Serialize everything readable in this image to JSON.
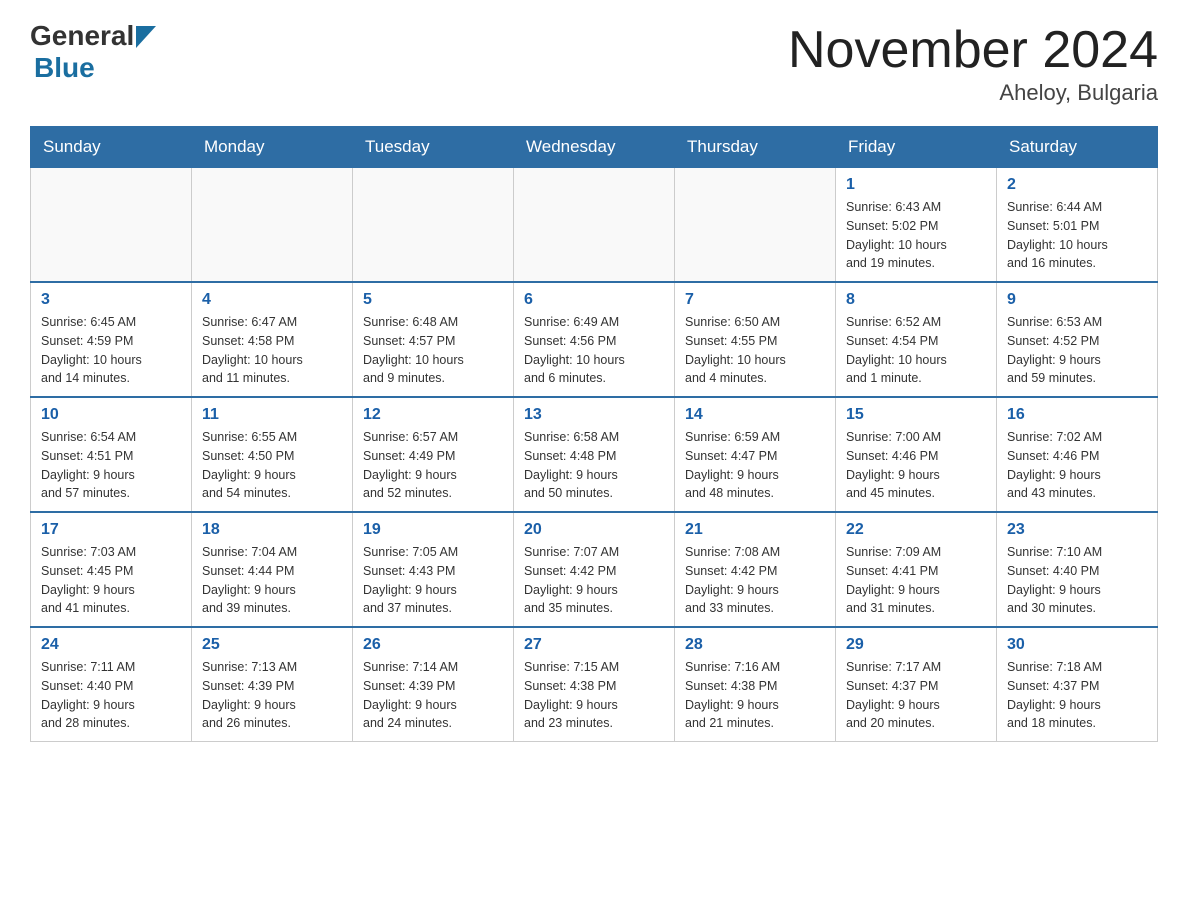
{
  "header": {
    "logo_general": "General",
    "logo_blue": "Blue",
    "month_title": "November 2024",
    "location": "Aheloy, Bulgaria"
  },
  "weekdays": [
    "Sunday",
    "Monday",
    "Tuesday",
    "Wednesday",
    "Thursday",
    "Friday",
    "Saturday"
  ],
  "weeks": [
    [
      {
        "day": "",
        "info": ""
      },
      {
        "day": "",
        "info": ""
      },
      {
        "day": "",
        "info": ""
      },
      {
        "day": "",
        "info": ""
      },
      {
        "day": "",
        "info": ""
      },
      {
        "day": "1",
        "info": "Sunrise: 6:43 AM\nSunset: 5:02 PM\nDaylight: 10 hours\nand 19 minutes."
      },
      {
        "day": "2",
        "info": "Sunrise: 6:44 AM\nSunset: 5:01 PM\nDaylight: 10 hours\nand 16 minutes."
      }
    ],
    [
      {
        "day": "3",
        "info": "Sunrise: 6:45 AM\nSunset: 4:59 PM\nDaylight: 10 hours\nand 14 minutes."
      },
      {
        "day": "4",
        "info": "Sunrise: 6:47 AM\nSunset: 4:58 PM\nDaylight: 10 hours\nand 11 minutes."
      },
      {
        "day": "5",
        "info": "Sunrise: 6:48 AM\nSunset: 4:57 PM\nDaylight: 10 hours\nand 9 minutes."
      },
      {
        "day": "6",
        "info": "Sunrise: 6:49 AM\nSunset: 4:56 PM\nDaylight: 10 hours\nand 6 minutes."
      },
      {
        "day": "7",
        "info": "Sunrise: 6:50 AM\nSunset: 4:55 PM\nDaylight: 10 hours\nand 4 minutes."
      },
      {
        "day": "8",
        "info": "Sunrise: 6:52 AM\nSunset: 4:54 PM\nDaylight: 10 hours\nand 1 minute."
      },
      {
        "day": "9",
        "info": "Sunrise: 6:53 AM\nSunset: 4:52 PM\nDaylight: 9 hours\nand 59 minutes."
      }
    ],
    [
      {
        "day": "10",
        "info": "Sunrise: 6:54 AM\nSunset: 4:51 PM\nDaylight: 9 hours\nand 57 minutes."
      },
      {
        "day": "11",
        "info": "Sunrise: 6:55 AM\nSunset: 4:50 PM\nDaylight: 9 hours\nand 54 minutes."
      },
      {
        "day": "12",
        "info": "Sunrise: 6:57 AM\nSunset: 4:49 PM\nDaylight: 9 hours\nand 52 minutes."
      },
      {
        "day": "13",
        "info": "Sunrise: 6:58 AM\nSunset: 4:48 PM\nDaylight: 9 hours\nand 50 minutes."
      },
      {
        "day": "14",
        "info": "Sunrise: 6:59 AM\nSunset: 4:47 PM\nDaylight: 9 hours\nand 48 minutes."
      },
      {
        "day": "15",
        "info": "Sunrise: 7:00 AM\nSunset: 4:46 PM\nDaylight: 9 hours\nand 45 minutes."
      },
      {
        "day": "16",
        "info": "Sunrise: 7:02 AM\nSunset: 4:46 PM\nDaylight: 9 hours\nand 43 minutes."
      }
    ],
    [
      {
        "day": "17",
        "info": "Sunrise: 7:03 AM\nSunset: 4:45 PM\nDaylight: 9 hours\nand 41 minutes."
      },
      {
        "day": "18",
        "info": "Sunrise: 7:04 AM\nSunset: 4:44 PM\nDaylight: 9 hours\nand 39 minutes."
      },
      {
        "day": "19",
        "info": "Sunrise: 7:05 AM\nSunset: 4:43 PM\nDaylight: 9 hours\nand 37 minutes."
      },
      {
        "day": "20",
        "info": "Sunrise: 7:07 AM\nSunset: 4:42 PM\nDaylight: 9 hours\nand 35 minutes."
      },
      {
        "day": "21",
        "info": "Sunrise: 7:08 AM\nSunset: 4:42 PM\nDaylight: 9 hours\nand 33 minutes."
      },
      {
        "day": "22",
        "info": "Sunrise: 7:09 AM\nSunset: 4:41 PM\nDaylight: 9 hours\nand 31 minutes."
      },
      {
        "day": "23",
        "info": "Sunrise: 7:10 AM\nSunset: 4:40 PM\nDaylight: 9 hours\nand 30 minutes."
      }
    ],
    [
      {
        "day": "24",
        "info": "Sunrise: 7:11 AM\nSunset: 4:40 PM\nDaylight: 9 hours\nand 28 minutes."
      },
      {
        "day": "25",
        "info": "Sunrise: 7:13 AM\nSunset: 4:39 PM\nDaylight: 9 hours\nand 26 minutes."
      },
      {
        "day": "26",
        "info": "Sunrise: 7:14 AM\nSunset: 4:39 PM\nDaylight: 9 hours\nand 24 minutes."
      },
      {
        "day": "27",
        "info": "Sunrise: 7:15 AM\nSunset: 4:38 PM\nDaylight: 9 hours\nand 23 minutes."
      },
      {
        "day": "28",
        "info": "Sunrise: 7:16 AM\nSunset: 4:38 PM\nDaylight: 9 hours\nand 21 minutes."
      },
      {
        "day": "29",
        "info": "Sunrise: 7:17 AM\nSunset: 4:37 PM\nDaylight: 9 hours\nand 20 minutes."
      },
      {
        "day": "30",
        "info": "Sunrise: 7:18 AM\nSunset: 4:37 PM\nDaylight: 9 hours\nand 18 minutes."
      }
    ]
  ]
}
